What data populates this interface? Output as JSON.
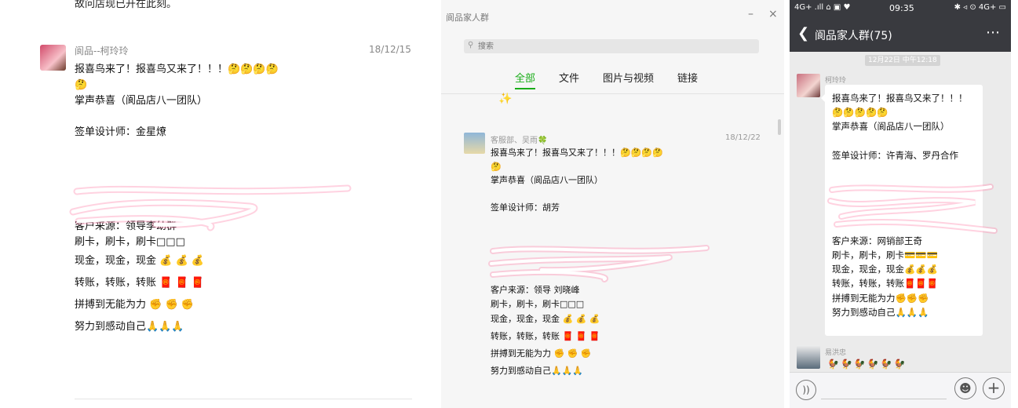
{
  "panel1": {
    "top_cut": "故问店现已开在此刻。",
    "sender": "阆品--柯玲玲",
    "date": "18/12/15",
    "lines": [
      "报喜鸟来了！报喜鸟又来了！！！🤔🤔🤔🤔",
      "🤔",
      "掌声恭喜（阆品店八一团队）",
      "",
      "签单设计师：金星燎",
      "",
      "",
      "",
      "",
      "",
      "客户来源：领导李幼群",
      "刷卡，刷卡，刷卡□□□",
      "现金，现金，现金 💰 💰 💰",
      "转账，转账，转账 🧧 🧧 🧧",
      "拼搏到无能为力 ✊ ✊ ✊",
      "努力到感动自己🙏🙏🙏"
    ]
  },
  "panel2": {
    "window_title": "阆品家人群",
    "min_icon": "minimize-icon",
    "close_icon": "close-icon",
    "search_placeholder": "搜索",
    "tabs": [
      "全部",
      "文件",
      "图片与视频",
      "链接"
    ],
    "active_tab": "全部",
    "sender": "客服部、吴雨🍀",
    "date": "18/12/22",
    "lines": [
      "报喜鸟来了！报喜鸟又来了！！！🤔🤔🤔🤔",
      "🤔",
      "掌声恭喜（阆品店八一团队）",
      "",
      "签单设计师：胡芳",
      "",
      "",
      "",
      "",
      "",
      "客户来源：领导 刘晓峰",
      "刷卡，刷卡，刷卡□□□",
      "现金，现金，现金 💰 💰 💰",
      "转账，转账，转账 🧧 🧧 🧧",
      "拼搏到无能为力 ✊ ✊ ✊",
      "努力到感动自己🙏🙏🙏"
    ]
  },
  "panel3": {
    "status_left": "4G+ .ıll ⌂ ▣ ♥",
    "status_time": "09:35",
    "status_right": "✱ ◃ ⊙ 4G+ ▭",
    "title": "阆品家人群(75)",
    "back_icon": "back-chevron-icon",
    "more_icon": "more-dots-icon",
    "timestamp": "12月22日 中午12:18",
    "sender1": "柯玲玲",
    "lines": [
      "报喜鸟来了！报喜鸟又来了！！！",
      "🤔🤔🤔🤔🤔",
      "掌声恭喜（阆品店八一团队）",
      "",
      "签单设计师：许青海、罗丹合作",
      "",
      "",
      "",
      "",
      "",
      "客户来源：网销部王奇",
      "刷卡，刷卡，刷卡💳💳💳",
      "现金，现金，现金💰💰💰",
      "转账，转账，转账🧧🧧🧧",
      "拼搏到无能为力✊✊✊",
      "努力到感动自己🙏🙏🙏"
    ],
    "sender2": "易洪忠",
    "row2": "🐓🐓🐓🐓🐓🐓",
    "voice_icon": "voice-icon",
    "emoji_icon": "emoji-icon",
    "plus_icon": "plus-icon"
  }
}
